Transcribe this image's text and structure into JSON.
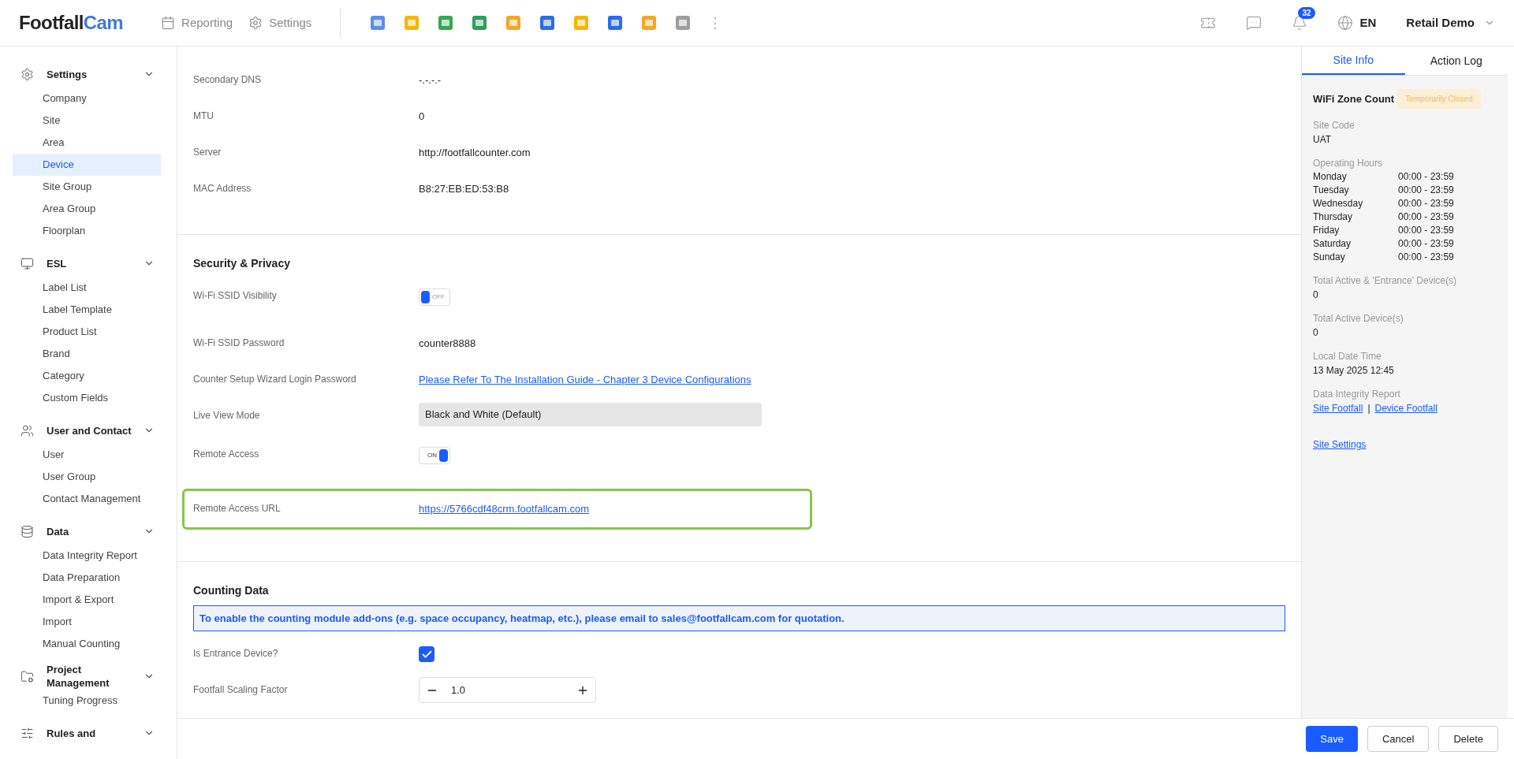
{
  "header": {
    "logo": {
      "part1": "Footfall",
      "part2": "Cam"
    },
    "nav": [
      {
        "label": "Reporting"
      },
      {
        "label": "Settings"
      }
    ],
    "more": "⋮",
    "notification_count": "32",
    "language": "EN",
    "account": "Retail Demo"
  },
  "sidebar": {
    "groups": [
      {
        "label": "Settings",
        "expanded": true,
        "items": [
          {
            "label": "Company",
            "selected": false
          },
          {
            "label": "Site",
            "selected": false
          },
          {
            "label": "Area",
            "selected": false
          },
          {
            "label": "Device",
            "selected": true
          },
          {
            "label": "Site Group",
            "selected": false
          },
          {
            "label": "Area Group",
            "selected": false
          },
          {
            "label": "Floorplan",
            "selected": false
          }
        ]
      },
      {
        "label": "ESL",
        "expanded": true,
        "items": [
          {
            "label": "Label List",
            "selected": false
          },
          {
            "label": "Label Template",
            "selected": false
          },
          {
            "label": "Product List",
            "selected": false
          },
          {
            "label": "Brand",
            "selected": false
          },
          {
            "label": "Category",
            "selected": false
          },
          {
            "label": "Custom Fields",
            "selected": false
          }
        ]
      },
      {
        "label": "User and Contact",
        "expanded": true,
        "items": [
          {
            "label": "User",
            "selected": false
          },
          {
            "label": "User Group",
            "selected": false
          },
          {
            "label": "Contact Management",
            "selected": false
          }
        ]
      },
      {
        "label": "Data",
        "expanded": true,
        "items": [
          {
            "label": "Data Integrity Report",
            "selected": false
          },
          {
            "label": "Data Preparation",
            "selected": false
          },
          {
            "label": "Import & Export",
            "selected": false
          },
          {
            "label": "Import",
            "selected": false
          },
          {
            "label": "Manual Counting",
            "selected": false
          }
        ]
      },
      {
        "label": "Project Management",
        "expanded": true,
        "items": [
          {
            "label": "Tuning Progress",
            "selected": false
          }
        ]
      },
      {
        "label": "Rules and",
        "expanded": true
      }
    ]
  },
  "sections": [
    {
      "rows": [
        {
          "kind": "text",
          "label": "Secondary DNS",
          "value": "-.-.-.-"
        },
        {
          "kind": "text",
          "label": "MTU",
          "value": "0"
        },
        {
          "kind": "text",
          "label": "Server",
          "value": "http://footfallcounter.com"
        },
        {
          "kind": "text",
          "label": "MAC Address",
          "value": "B8:27:EB:ED:53:B8"
        }
      ]
    },
    {
      "title": "Security & Privacy",
      "rows": [
        {
          "kind": "toggle",
          "label": "Wi-Fi SSID Visibility",
          "on": false,
          "text": "OFF"
        },
        {
          "kind": "text",
          "label": "Wi-Fi SSID Password",
          "value": "counter8888"
        },
        {
          "kind": "link",
          "label": "Counter Setup Wizard Login Password",
          "value": "Please Refer To The Installation Guide - Chapter 3 Device Configurations"
        },
        {
          "kind": "select",
          "label": "Live View Mode",
          "value": "Black and White (Default)"
        },
        {
          "kind": "toggle",
          "label": "Remote Access",
          "on": true,
          "text": "ON"
        },
        {
          "kind": "link",
          "label": "Remote Access URL",
          "value": "https://5766cdf48crm.footfallcam.com",
          "highlighted": true
        }
      ]
    },
    {
      "title": "Counting Data",
      "notice": "To enable the counting module add-ons (e.g. space occupancy, heatmap, etc.), please email to sales@footfallcam.com for quotation.",
      "rows": [
        {
          "kind": "checkbox",
          "label": "Is Entrance Device?",
          "checked": true
        },
        {
          "kind": "stepper",
          "label": "Footfall Scaling Factor",
          "value": "1.0"
        }
      ]
    }
  ],
  "panel": {
    "tabs": [
      {
        "label": "Site Info",
        "selected": true
      },
      {
        "label": "Action Log",
        "selected": false
      }
    ],
    "title": "WiFi Zone Count",
    "status": "Temporarily Closed",
    "site_code": {
      "label": "Site Code",
      "value": "UAT"
    },
    "hours": {
      "label": "Operating Hours",
      "days": [
        {
          "day": "Monday",
          "time": "00:00 - 23:59"
        },
        {
          "day": "Tuesday",
          "time": "00:00 - 23:59"
        },
        {
          "day": "Wednesday",
          "time": "00:00 - 23:59"
        },
        {
          "day": "Thursday",
          "time": "00:00 - 23:59"
        },
        {
          "day": "Friday",
          "time": "00:00 - 23:59"
        },
        {
          "day": "Saturday",
          "time": "00:00 - 23:59"
        },
        {
          "day": "Sunday",
          "time": "00:00 - 23:59"
        }
      ]
    },
    "fields": [
      {
        "label": "Total Active & 'Entrance' Device(s)",
        "value": "0"
      },
      {
        "label": "Total Active Device(s)",
        "value": "0"
      },
      {
        "label": "Local Date Time",
        "value": "13 May 2025 12:45"
      }
    ],
    "report": {
      "label": "Data Integrity Report",
      "links": [
        "Site Footfall",
        "Device Footfall"
      ],
      "separator": "|"
    },
    "settings_link": "Site Settings"
  },
  "footer": {
    "buttons": [
      {
        "label": "Save",
        "kind": "primary"
      },
      {
        "label": "Cancel",
        "kind": "default"
      },
      {
        "label": "Delete",
        "kind": "default"
      }
    ]
  }
}
